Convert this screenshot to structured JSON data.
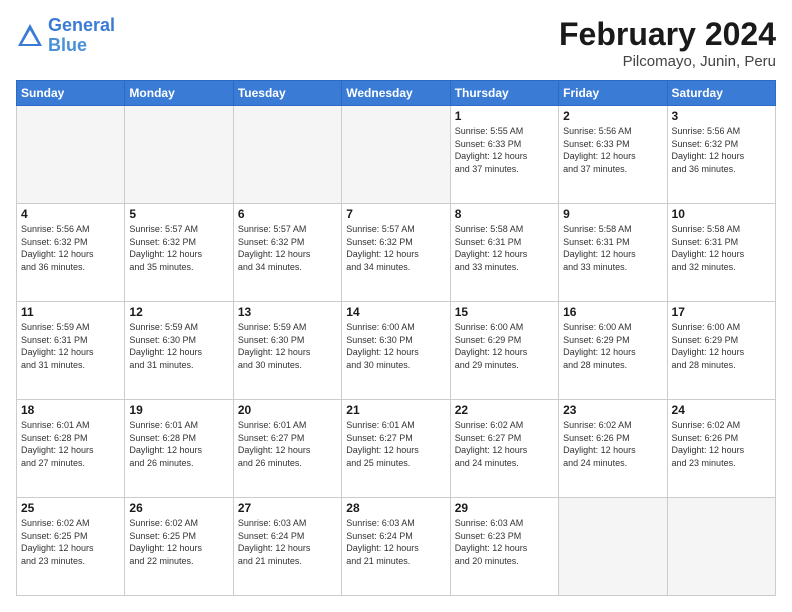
{
  "logo": {
    "line1": "General",
    "line2": "Blue"
  },
  "title": "February 2024",
  "subtitle": "Pilcomayo, Junin, Peru",
  "weekdays": [
    "Sunday",
    "Monday",
    "Tuesday",
    "Wednesday",
    "Thursday",
    "Friday",
    "Saturday"
  ],
  "weeks": [
    [
      {
        "day": "",
        "info": ""
      },
      {
        "day": "",
        "info": ""
      },
      {
        "day": "",
        "info": ""
      },
      {
        "day": "",
        "info": ""
      },
      {
        "day": "1",
        "info": "Sunrise: 5:55 AM\nSunset: 6:33 PM\nDaylight: 12 hours\nand 37 minutes."
      },
      {
        "day": "2",
        "info": "Sunrise: 5:56 AM\nSunset: 6:33 PM\nDaylight: 12 hours\nand 37 minutes."
      },
      {
        "day": "3",
        "info": "Sunrise: 5:56 AM\nSunset: 6:32 PM\nDaylight: 12 hours\nand 36 minutes."
      }
    ],
    [
      {
        "day": "4",
        "info": "Sunrise: 5:56 AM\nSunset: 6:32 PM\nDaylight: 12 hours\nand 36 minutes."
      },
      {
        "day": "5",
        "info": "Sunrise: 5:57 AM\nSunset: 6:32 PM\nDaylight: 12 hours\nand 35 minutes."
      },
      {
        "day": "6",
        "info": "Sunrise: 5:57 AM\nSunset: 6:32 PM\nDaylight: 12 hours\nand 34 minutes."
      },
      {
        "day": "7",
        "info": "Sunrise: 5:57 AM\nSunset: 6:32 PM\nDaylight: 12 hours\nand 34 minutes."
      },
      {
        "day": "8",
        "info": "Sunrise: 5:58 AM\nSunset: 6:31 PM\nDaylight: 12 hours\nand 33 minutes."
      },
      {
        "day": "9",
        "info": "Sunrise: 5:58 AM\nSunset: 6:31 PM\nDaylight: 12 hours\nand 33 minutes."
      },
      {
        "day": "10",
        "info": "Sunrise: 5:58 AM\nSunset: 6:31 PM\nDaylight: 12 hours\nand 32 minutes."
      }
    ],
    [
      {
        "day": "11",
        "info": "Sunrise: 5:59 AM\nSunset: 6:31 PM\nDaylight: 12 hours\nand 31 minutes."
      },
      {
        "day": "12",
        "info": "Sunrise: 5:59 AM\nSunset: 6:30 PM\nDaylight: 12 hours\nand 31 minutes."
      },
      {
        "day": "13",
        "info": "Sunrise: 5:59 AM\nSunset: 6:30 PM\nDaylight: 12 hours\nand 30 minutes."
      },
      {
        "day": "14",
        "info": "Sunrise: 6:00 AM\nSunset: 6:30 PM\nDaylight: 12 hours\nand 30 minutes."
      },
      {
        "day": "15",
        "info": "Sunrise: 6:00 AM\nSunset: 6:29 PM\nDaylight: 12 hours\nand 29 minutes."
      },
      {
        "day": "16",
        "info": "Sunrise: 6:00 AM\nSunset: 6:29 PM\nDaylight: 12 hours\nand 28 minutes."
      },
      {
        "day": "17",
        "info": "Sunrise: 6:00 AM\nSunset: 6:29 PM\nDaylight: 12 hours\nand 28 minutes."
      }
    ],
    [
      {
        "day": "18",
        "info": "Sunrise: 6:01 AM\nSunset: 6:28 PM\nDaylight: 12 hours\nand 27 minutes."
      },
      {
        "day": "19",
        "info": "Sunrise: 6:01 AM\nSunset: 6:28 PM\nDaylight: 12 hours\nand 26 minutes."
      },
      {
        "day": "20",
        "info": "Sunrise: 6:01 AM\nSunset: 6:27 PM\nDaylight: 12 hours\nand 26 minutes."
      },
      {
        "day": "21",
        "info": "Sunrise: 6:01 AM\nSunset: 6:27 PM\nDaylight: 12 hours\nand 25 minutes."
      },
      {
        "day": "22",
        "info": "Sunrise: 6:02 AM\nSunset: 6:27 PM\nDaylight: 12 hours\nand 24 minutes."
      },
      {
        "day": "23",
        "info": "Sunrise: 6:02 AM\nSunset: 6:26 PM\nDaylight: 12 hours\nand 24 minutes."
      },
      {
        "day": "24",
        "info": "Sunrise: 6:02 AM\nSunset: 6:26 PM\nDaylight: 12 hours\nand 23 minutes."
      }
    ],
    [
      {
        "day": "25",
        "info": "Sunrise: 6:02 AM\nSunset: 6:25 PM\nDaylight: 12 hours\nand 23 minutes."
      },
      {
        "day": "26",
        "info": "Sunrise: 6:02 AM\nSunset: 6:25 PM\nDaylight: 12 hours\nand 22 minutes."
      },
      {
        "day": "27",
        "info": "Sunrise: 6:03 AM\nSunset: 6:24 PM\nDaylight: 12 hours\nand 21 minutes."
      },
      {
        "day": "28",
        "info": "Sunrise: 6:03 AM\nSunset: 6:24 PM\nDaylight: 12 hours\nand 21 minutes."
      },
      {
        "day": "29",
        "info": "Sunrise: 6:03 AM\nSunset: 6:23 PM\nDaylight: 12 hours\nand 20 minutes."
      },
      {
        "day": "",
        "info": ""
      },
      {
        "day": "",
        "info": ""
      }
    ]
  ]
}
